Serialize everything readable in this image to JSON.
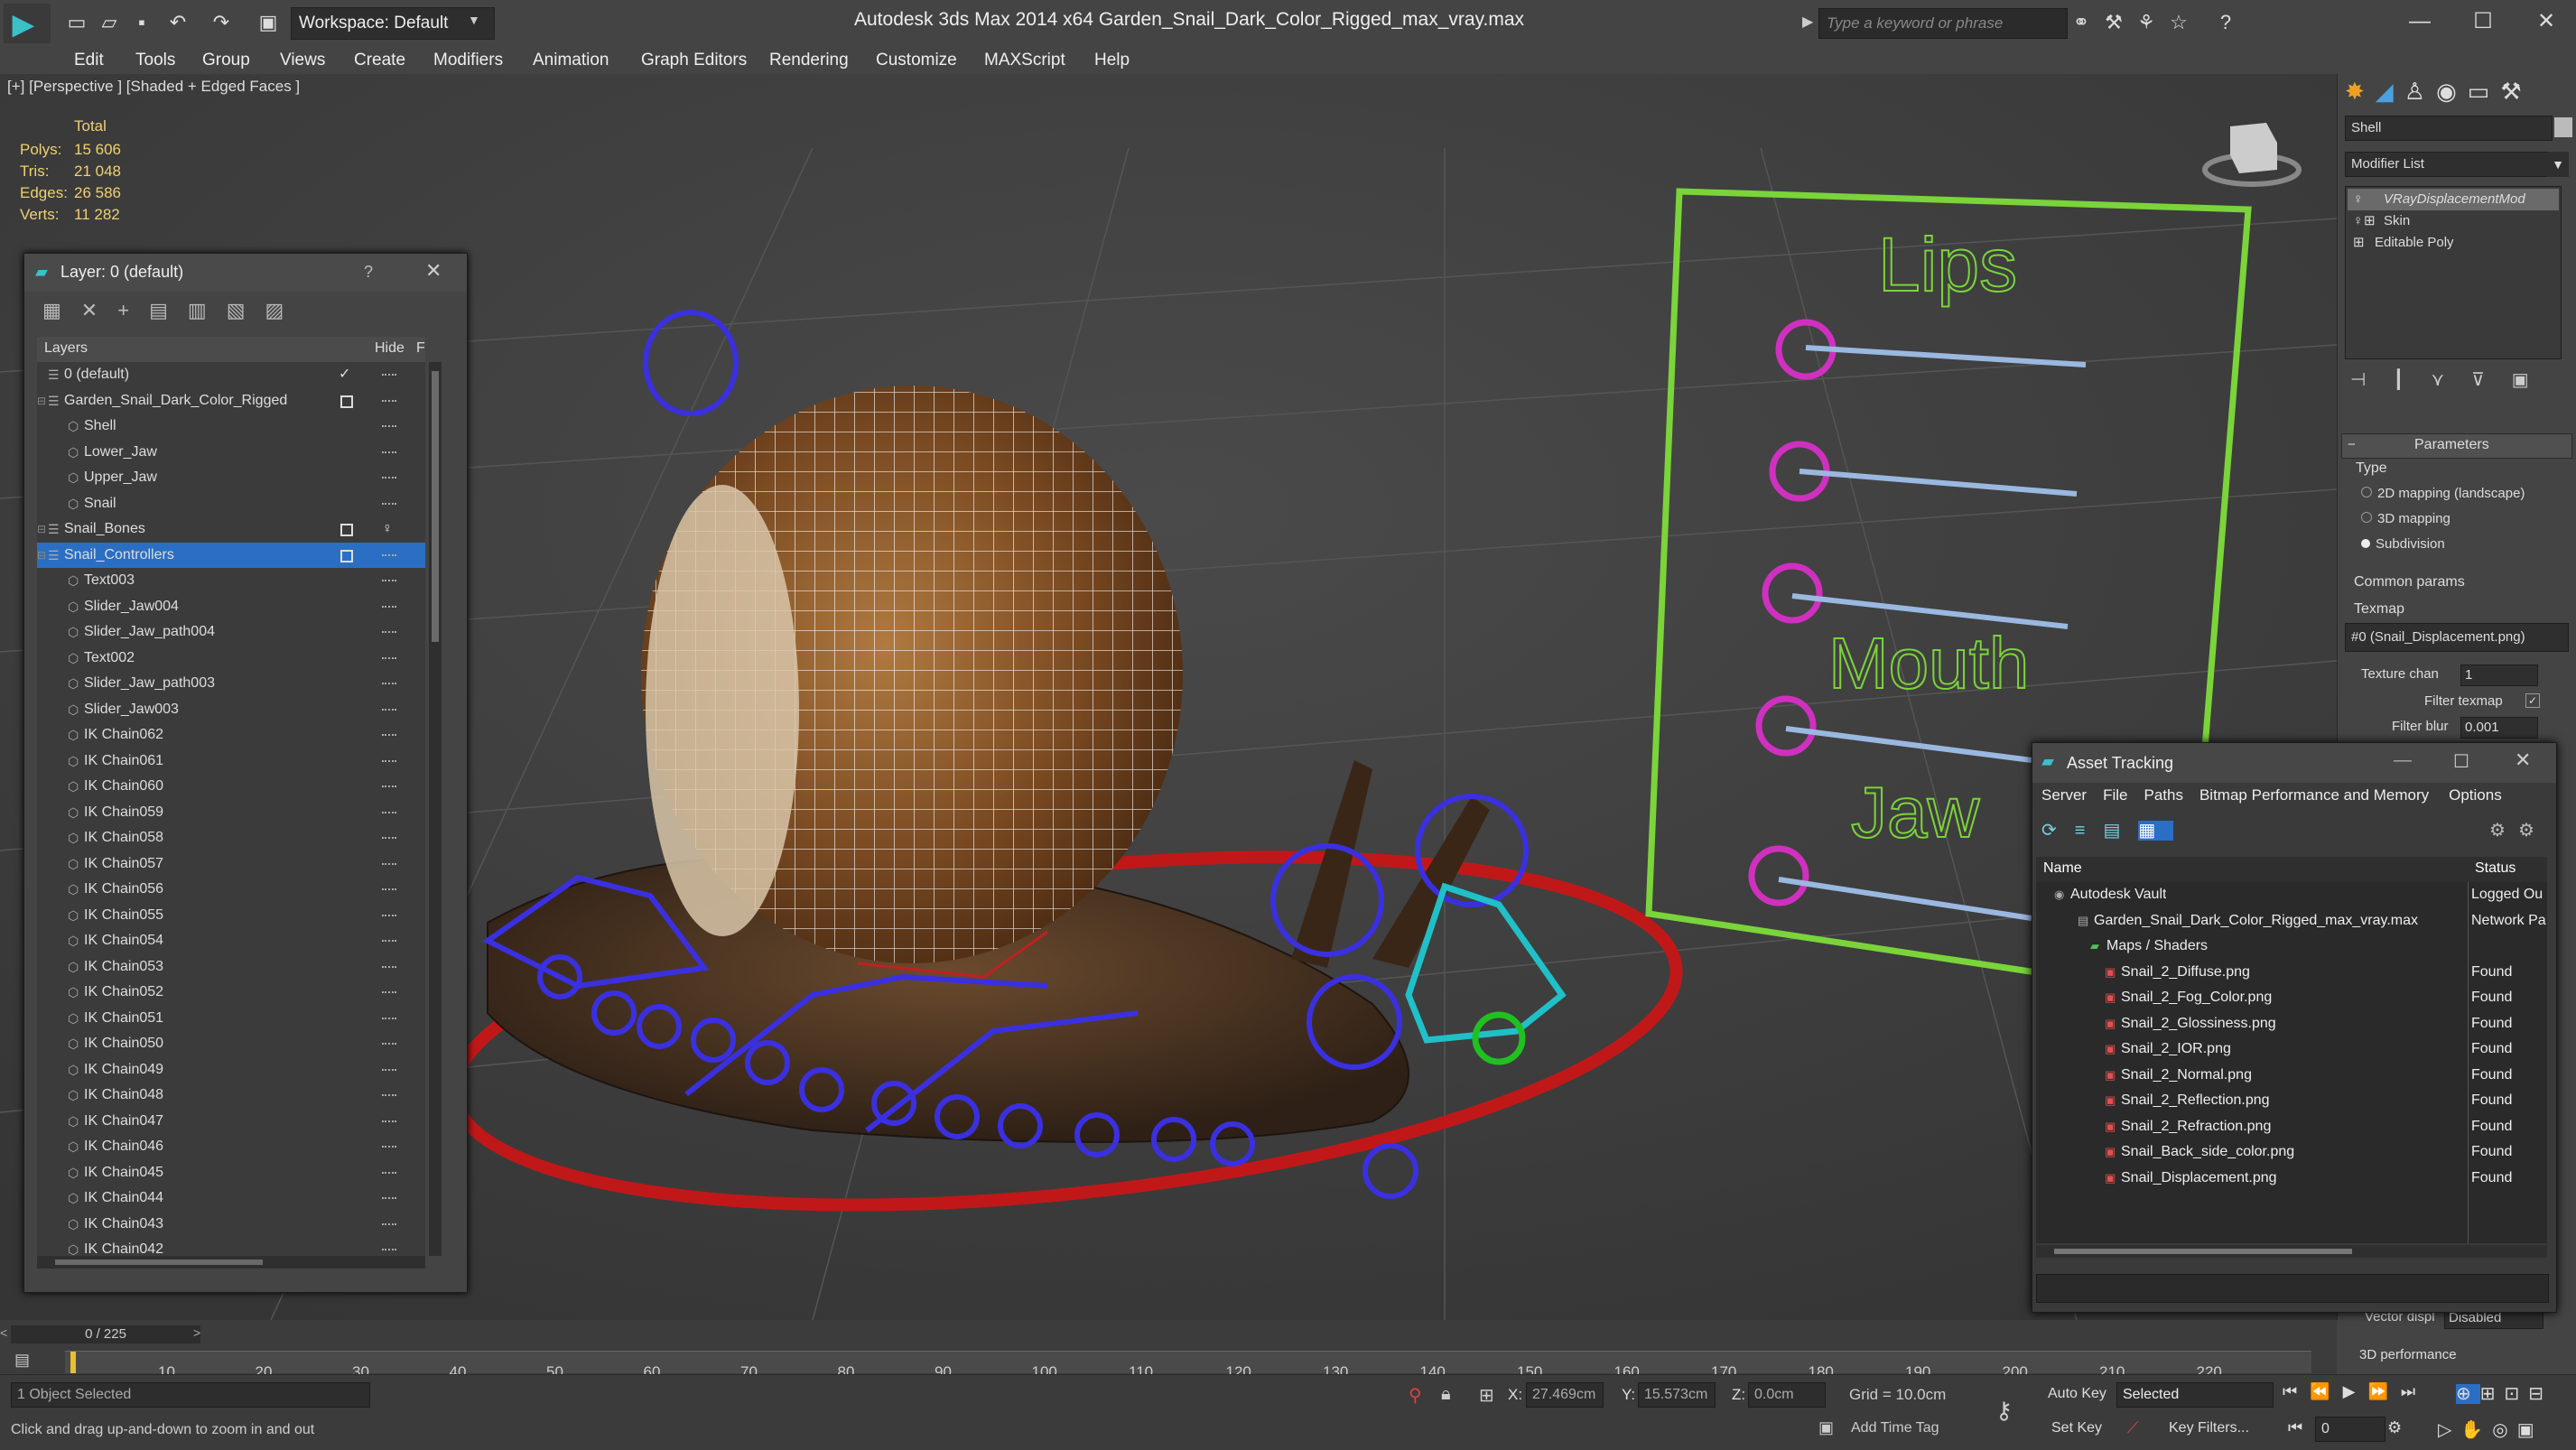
{
  "titlebar": {
    "workspace": "Workspace: Default",
    "title": "Autodesk 3ds Max  2014 x64      Garden_Snail_Dark_Color_Rigged_max_vray.max",
    "search_placeholder": "Type a keyword or phrase"
  },
  "menu": [
    "Edit",
    "Tools",
    "Group",
    "Views",
    "Create",
    "Modifiers",
    "Animation",
    "Graph Editors",
    "Rendering",
    "Customize",
    "MAXScript",
    "Help"
  ],
  "viewport": {
    "label": "[+] [Perspective ] [Shaded + Edged Faces ]",
    "stats": {
      "total_label": "Total",
      "rows": [
        {
          "label": "Polys:",
          "value": "15 606"
        },
        {
          "label": "Tris:",
          "value": "21 048"
        },
        {
          "label": "Edges:",
          "value": "26 586"
        },
        {
          "label": "Verts:",
          "value": "11 282"
        }
      ]
    },
    "board": {
      "lips": "Lips",
      "mouth": "Mouth",
      "jaw": "Jaw"
    }
  },
  "layer_panel": {
    "title": "Layer: 0 (default)",
    "help": "?",
    "col_layers": "Layers",
    "col_hide": "Hide",
    "col_f": "F",
    "rows": [
      {
        "name": "0 (default)",
        "level": 0,
        "check": true
      },
      {
        "name": "Garden_Snail_Dark_Color_Rigged",
        "level": 0,
        "box": true
      },
      {
        "name": "Shell",
        "level": 1
      },
      {
        "name": "Lower_Jaw",
        "level": 1
      },
      {
        "name": "Upper_Jaw",
        "level": 1
      },
      {
        "name": "Snail",
        "level": 1
      },
      {
        "name": "Snail_Bones",
        "level": 0,
        "box": true,
        "bulb": true
      },
      {
        "name": "Snail_Controllers",
        "level": 0,
        "box": true,
        "selected": true
      },
      {
        "name": "Text003",
        "level": 1
      },
      {
        "name": "Slider_Jaw004",
        "level": 1
      },
      {
        "name": "Slider_Jaw_path004",
        "level": 1
      },
      {
        "name": "Text002",
        "level": 1
      },
      {
        "name": "Slider_Jaw_path003",
        "level": 1
      },
      {
        "name": "Slider_Jaw003",
        "level": 1
      },
      {
        "name": "IK Chain062",
        "level": 1
      },
      {
        "name": "IK Chain061",
        "level": 1
      },
      {
        "name": "IK Chain060",
        "level": 1
      },
      {
        "name": "IK Chain059",
        "level": 1
      },
      {
        "name": "IK Chain058",
        "level": 1
      },
      {
        "name": "IK Chain057",
        "level": 1
      },
      {
        "name": "IK Chain056",
        "level": 1
      },
      {
        "name": "IK Chain055",
        "level": 1
      },
      {
        "name": "IK Chain054",
        "level": 1
      },
      {
        "name": "IK Chain053",
        "level": 1
      },
      {
        "name": "IK Chain052",
        "level": 1
      },
      {
        "name": "IK Chain051",
        "level": 1
      },
      {
        "name": "IK Chain050",
        "level": 1
      },
      {
        "name": "IK Chain049",
        "level": 1
      },
      {
        "name": "IK Chain048",
        "level": 1
      },
      {
        "name": "IK Chain047",
        "level": 1
      },
      {
        "name": "IK Chain046",
        "level": 1
      },
      {
        "name": "IK Chain045",
        "level": 1
      },
      {
        "name": "IK Chain044",
        "level": 1
      },
      {
        "name": "IK Chain043",
        "level": 1
      },
      {
        "name": "IK Chain042",
        "level": 1
      }
    ]
  },
  "command_panel": {
    "object_name": "Shell",
    "modifier_list": "Modifier List",
    "stack": [
      "VRayDisplacementMod",
      "Skin",
      "Editable Poly"
    ],
    "parameters": "Parameters",
    "type_label": "Type",
    "type_options": [
      "2D mapping (landscape)",
      "3D mapping",
      "Subdivision"
    ],
    "type_selected": 2,
    "common_params": "Common params",
    "texmap_label": "Texmap",
    "texmap_value": "#0 (Snail_Displacement.png)",
    "texture_chan_label": "Texture chan",
    "texture_chan_value": "1",
    "filter_texmap": "Filter texmap",
    "filter_blur_label": "Filter blur",
    "filter_blur_value": "0.001",
    "vector_disp_label": "Vector displ",
    "vector_disp_value": "Disabled",
    "perf_label": "3D performance"
  },
  "asset_tracking": {
    "title": "Asset Tracking",
    "menu": [
      "Server",
      "File",
      "Paths",
      "Bitmap Performance and Memory",
      "Options"
    ],
    "col_name": "Name",
    "col_status": "Status",
    "rows": [
      {
        "name": "Autodesk Vault",
        "status": "Logged Ou",
        "level": 0
      },
      {
        "name": "Garden_Snail_Dark_Color_Rigged_max_vray.max",
        "status": "Network Pa",
        "level": 1
      },
      {
        "name": "Maps / Shaders",
        "status": "",
        "level": 2
      },
      {
        "name": "Snail_2_Diffuse.png",
        "status": "Found",
        "level": 3
      },
      {
        "name": "Snail_2_Fog_Color.png",
        "status": "Found",
        "level": 3
      },
      {
        "name": "Snail_2_Glossiness.png",
        "status": "Found",
        "level": 3
      },
      {
        "name": "Snail_2_IOR.png",
        "status": "Found",
        "level": 3
      },
      {
        "name": "Snail_2_Normal.png",
        "status": "Found",
        "level": 3
      },
      {
        "name": "Snail_2_Reflection.png",
        "status": "Found",
        "level": 3
      },
      {
        "name": "Snail_2_Refraction.png",
        "status": "Found",
        "level": 3
      },
      {
        "name": "Snail_Back_side_color.png",
        "status": "Found",
        "level": 3
      },
      {
        "name": "Snail_Displacement.png",
        "status": "Found",
        "level": 3
      }
    ]
  },
  "timeline": {
    "frame": "0 / 225",
    "ticks": [
      "10",
      "20",
      "30",
      "40",
      "50",
      "60",
      "70",
      "80",
      "90",
      "100",
      "110",
      "120",
      "130",
      "140",
      "150",
      "160",
      "170",
      "180",
      "190",
      "200",
      "210",
      "220"
    ]
  },
  "status": {
    "selection": "1 Object Selected",
    "prompt": "Click and drag up-and-down to zoom in and out",
    "x_label": "X:",
    "x_value": "27.469cm",
    "y_label": "Y:",
    "y_value": "15.573cm",
    "z_label": "Z:",
    "z_value": "0.0cm",
    "grid": "Grid = 10.0cm",
    "add_time_tag": "Add Time Tag",
    "auto_key": "Auto Key",
    "set_key": "Set Key",
    "key_mode": "Selected",
    "key_filters": "Key Filters...",
    "frame_field": "0"
  }
}
